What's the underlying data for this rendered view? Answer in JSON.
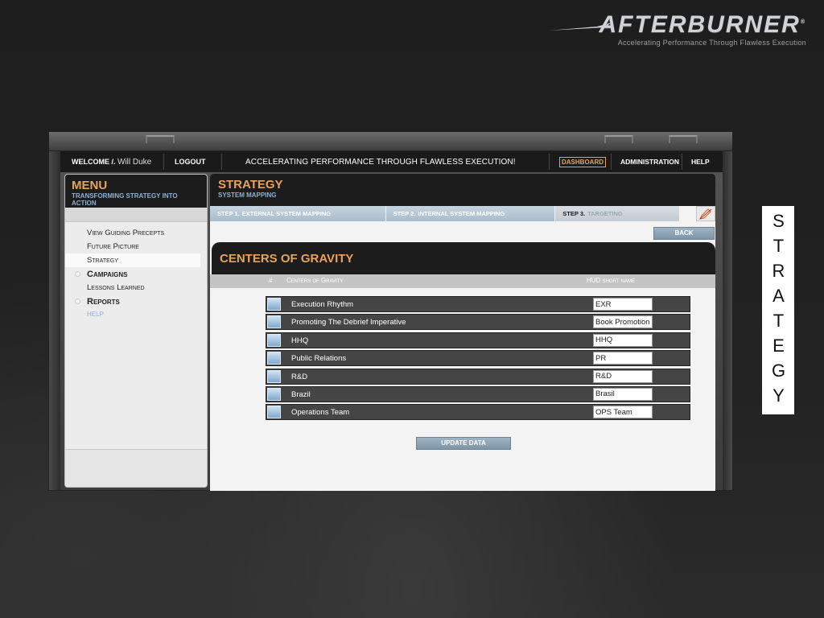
{
  "brand": {
    "name": "AFTERBURNER",
    "trademark": "®",
    "tagline": "Accelerating Performance Through Flawless Execution"
  },
  "side_label": "STRATEGY",
  "topbar": {
    "welcome_label": "WELCOME /.",
    "user_name": "Will Duke",
    "logout": "LOGOUT",
    "tagline": "ACCELERATING PERFORMANCE THROUGH FLAWLESS EXECUTION!",
    "dashboard": "DASHBOARD",
    "administration": "ADMINISTRATION",
    "help": "HELP"
  },
  "menu": {
    "title": "MENU",
    "subtitle": "TRANSFORMING STRATEGY INTO ACTION",
    "items": [
      {
        "label": "View Guiding Precepts"
      },
      {
        "label": "Future Picture"
      },
      {
        "label": "Strategy"
      },
      {
        "label": "Campaigns"
      },
      {
        "label": "Lessons Learned"
      },
      {
        "label": "Reports"
      },
      {
        "label": "HELP"
      }
    ]
  },
  "main": {
    "title": "STRATEGY",
    "subtitle": "SYSTEM MAPPING",
    "steps": [
      {
        "num": "STEP 1.",
        "label": "EXTERNAL SYSTEM MAPPING"
      },
      {
        "num": "STEP 2.",
        "label": "INTERNAL SYSTEM MAPPING"
      },
      {
        "num": "STEP 3.",
        "label": "TARGETING"
      }
    ],
    "back": "BACK",
    "section_title": "CENTERS OF GRAVITY",
    "columns": {
      "hash": "#",
      "name": "Centers of Gravity",
      "short": "HUD short name"
    },
    "rows": [
      {
        "name": "Execution Rhythm",
        "short": "EXR"
      },
      {
        "name": "Promoting The Debrief Imperative",
        "short": "Book Promotion"
      },
      {
        "name": "HHQ",
        "short": "HHQ"
      },
      {
        "name": "Public Relations",
        "short": "PR"
      },
      {
        "name": "R&D",
        "short": "R&D"
      },
      {
        "name": "Brazil",
        "short": "Brasil"
      },
      {
        "name": "Operations Team",
        "short": "OPS Team"
      }
    ],
    "update": "UPDATE DATA"
  },
  "colors": {
    "accent": "#e8a35a",
    "subtitle_blue": "#8fb0d0",
    "header_dark": "#1c1c1c",
    "row_bg": "#454545"
  },
  "icons": {
    "step_edit": "edit-pencil-icon",
    "row_handle": "drag-handle-icon"
  }
}
